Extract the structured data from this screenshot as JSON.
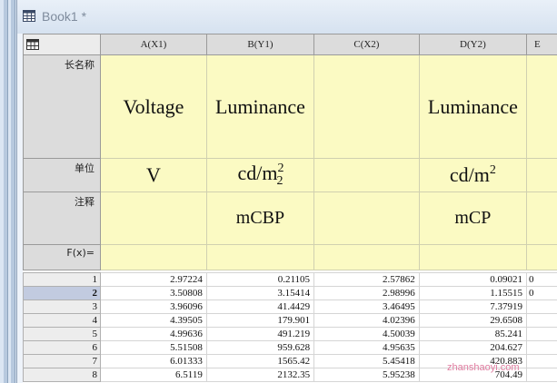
{
  "window": {
    "title": "Book1 *"
  },
  "columns": [
    "A(X1)",
    "B(Y1)",
    "C(X2)",
    "D(Y2)",
    "E"
  ],
  "row_labels": {
    "long_name": "长名称",
    "units": "单位",
    "comments": "注释",
    "fx": "F(x)="
  },
  "meta": {
    "long_name": [
      "Voltage",
      "Luminance",
      "",
      "Luminance",
      ""
    ],
    "units": [
      "V",
      "cd/m",
      "",
      "cd/m",
      ""
    ],
    "units_sup": [
      "",
      "2",
      "",
      "2",
      ""
    ],
    "units_sub": [
      "",
      "2",
      "",
      "",
      ""
    ],
    "comments": [
      "",
      "mCBP",
      "",
      "mCP",
      ""
    ]
  },
  "selected_row": 2,
  "rows": [
    {
      "n": "1",
      "cells": [
        "2.97224",
        "0.21105",
        "2.57862",
        "0.09021",
        "0"
      ]
    },
    {
      "n": "2",
      "cells": [
        "3.50808",
        "3.15414",
        "2.98996",
        "1.15515",
        "0"
      ]
    },
    {
      "n": "3",
      "cells": [
        "3.96096",
        "41.4429",
        "3.46495",
        "7.37919",
        ""
      ]
    },
    {
      "n": "4",
      "cells": [
        "4.39505",
        "179.901",
        "4.02396",
        "29.6508",
        ""
      ]
    },
    {
      "n": "5",
      "cells": [
        "4.99636",
        "491.219",
        "4.50039",
        "85.241",
        ""
      ]
    },
    {
      "n": "6",
      "cells": [
        "5.51508",
        "959.628",
        "4.95635",
        "204.627",
        ""
      ]
    },
    {
      "n": "7",
      "cells": [
        "6.01333",
        "1565.42",
        "5.45418",
        "420.883",
        ""
      ]
    },
    {
      "n": "8",
      "cells": [
        "6.5119",
        "2132.35",
        "5.95238",
        "704.49",
        ""
      ]
    }
  ],
  "watermark": "zhanshaoyi.com"
}
